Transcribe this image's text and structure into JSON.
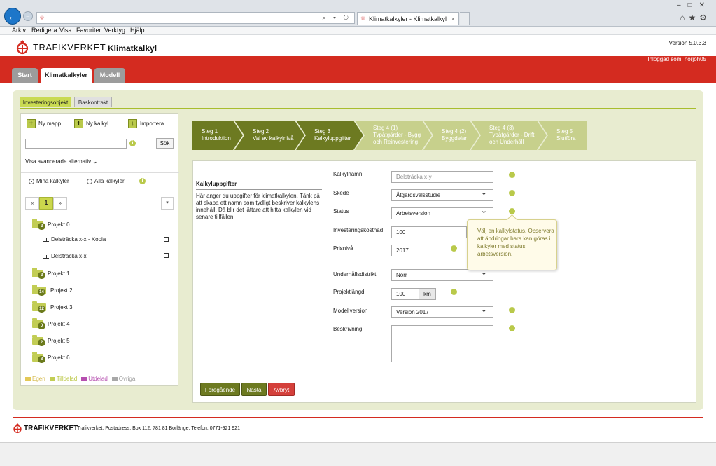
{
  "browser": {
    "tab_title": "Klimatkalkyler - Klimatkalkyl",
    "tab_close": "×",
    "address_tools": "⌕ ▾ ↻",
    "menu": [
      "Arkiv",
      "Redigera",
      "Visa",
      "Favoriter",
      "Verktyg",
      "Hjälp"
    ]
  },
  "header": {
    "brand": "TRAFIKVERKET",
    "app_title": "Klimatkalkyl",
    "version": "Version 5.0.3.3",
    "logged_in": "Inloggad som: norjoh05"
  },
  "main_tabs": [
    "Start",
    "Klimatkalkyler",
    "Modell"
  ],
  "sub_tabs": [
    "Investeringsobjekt",
    "Baskontrakt"
  ],
  "left": {
    "new_folder": "Ny mapp",
    "new_calc": "Ny kalkyl",
    "import": "Importera",
    "search_button": "Sök",
    "advanced": "Visa avancerade alternativ",
    "radio_mine": "Mina kalkyler",
    "radio_all": "Alla kalkyler",
    "pager": [
      "«",
      "1",
      "»"
    ],
    "tree": [
      {
        "name": "Projekt 0",
        "count": "2"
      },
      {
        "name": "Projekt 1",
        "count": "2"
      },
      {
        "name": "Projekt 2",
        "count": "14"
      },
      {
        "name": "Projekt 3",
        "count": "12"
      },
      {
        "name": "Projekt 4",
        "count": "0"
      },
      {
        "name": "Projekt 5",
        "count": "2"
      },
      {
        "name": "Projekt 6",
        "count": "8"
      }
    ],
    "calcs": [
      "Delsträcka x-x - Kopia",
      "Delsträcka x-x"
    ],
    "legend": [
      "Egen",
      "Tilldelad",
      "Utdelad",
      "Övriga"
    ]
  },
  "steps": [
    {
      "l1": "Steg 1",
      "l2": "Introduktion",
      "l3": ""
    },
    {
      "l1": "Steg 2",
      "l2": "Val av kalkylnivå",
      "l3": ""
    },
    {
      "l1": "Steg 3",
      "l2": "Kalkyluppgifter",
      "l3": ""
    },
    {
      "l1": "Steg 4 (1)",
      "l2": "Typåtgärder - Bygg",
      "l3": "och Reinvestering"
    },
    {
      "l1": "Steg 4 (2)",
      "l2": "Byggdelar",
      "l3": ""
    },
    {
      "l1": "Steg 4 (3)",
      "l2": "Typåtgärder - Drift",
      "l3": "och Underhåll"
    },
    {
      "l1": "Steg 5",
      "l2": "Slutföra",
      "l3": ""
    }
  ],
  "form": {
    "help_title": "Kalkyluppgifter",
    "help_text": "Här anger du uppgifter för klimatkalkylen. Tänk på att skapa ett namn som tydligt beskriver kalkylens innehåll. Då blir det lättare att hitta kalkylen vid senare tillfällen.",
    "labels": {
      "name": "Kalkylnamn",
      "stage": "Skede",
      "status": "Status",
      "investment": "Investeringskostnad",
      "price_level": "Prisnivå",
      "district": "Underhållsdistrikt",
      "length": "Projektlängd",
      "model_version": "Modellversion",
      "description": "Beskrivning"
    },
    "values": {
      "name_placeholder": "Delsträcka x-y",
      "stage": "Åtgärdsvalsstudie",
      "status": "Arbetsversion",
      "investment": "100",
      "price_level": "2017",
      "district": "Norr",
      "length": "100",
      "length_unit": "km",
      "model_version": "Version 2017"
    },
    "tooltip": "Välj en kalkylstatus. Observera att ändringar bara kan göras i kalkyler med status arbetsversion.",
    "buttons": {
      "prev": "Föregående",
      "next": "Nästa",
      "cancel": "Avbryt"
    }
  },
  "footer": {
    "brand": "TRAFIKVERKET",
    "address": "Trafikverket, Postadress: Box 112, 781 81 Borlänge, Telefon: 0771-921 921"
  },
  "colors": {
    "brand_red": "#d42b20",
    "step_done": "#6d7a21",
    "step_todo": "#c7d08c",
    "accent_green": "#b9c94a",
    "cancel_red": "#d4403b"
  }
}
